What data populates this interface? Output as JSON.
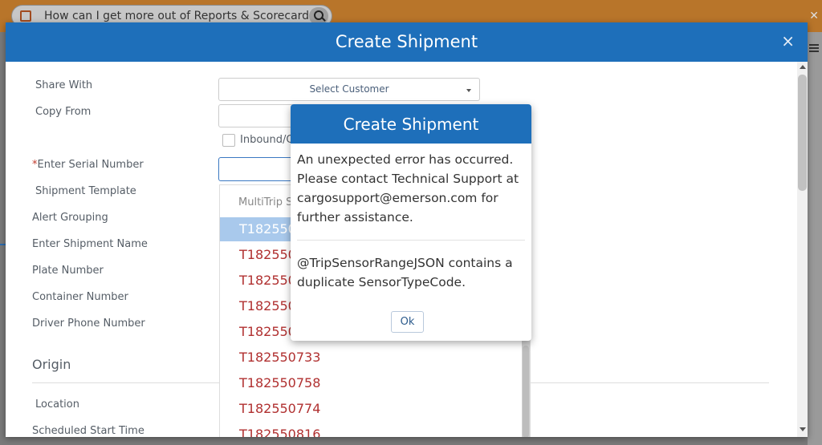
{
  "background": {
    "search_query": "How can I get more out of Reports & Scorecards?"
  },
  "modal": {
    "title": "Create Shipment",
    "close_label": "×"
  },
  "form": {
    "share_with_label": "Share With",
    "share_with_value": "Select Customer",
    "copy_from_label": "Copy From",
    "inbound_label": "Inbound/O",
    "serial_required": "*",
    "serial_label": "Enter Serial Number",
    "template_label": "Shipment Template",
    "alert_grouping_label": "Alert Grouping",
    "shipment_name_label": "Enter Shipment Name",
    "plate_label": "Plate Number",
    "container_label": "Container Number",
    "driver_phone_label": "Driver Phone Number",
    "origin_title": "Origin",
    "location_label": "Location",
    "scheduled_start_label": "Scheduled Start Time"
  },
  "dropdown": {
    "group_label": "MultiTrip S",
    "items": [
      "T182550",
      "T182550",
      "T182550",
      "T182550",
      "T182550",
      "T182550733",
      "T182550758",
      "T182550774",
      "T182550816"
    ]
  },
  "error_dialog": {
    "title": "Create Shipment",
    "message": "An unexpected error has occurred. Please contact Technical Support at cargosupport@emerson.com for further assistance.",
    "detail": "@TripSensorRangeJSON contains a duplicate SensorTypeCode.",
    "ok_label": "Ok"
  },
  "colors": {
    "header_blue": "#1e6fba",
    "required_red": "#c0392b",
    "serial_red": "#b03030",
    "selected_bg": "#a9c9ec"
  }
}
